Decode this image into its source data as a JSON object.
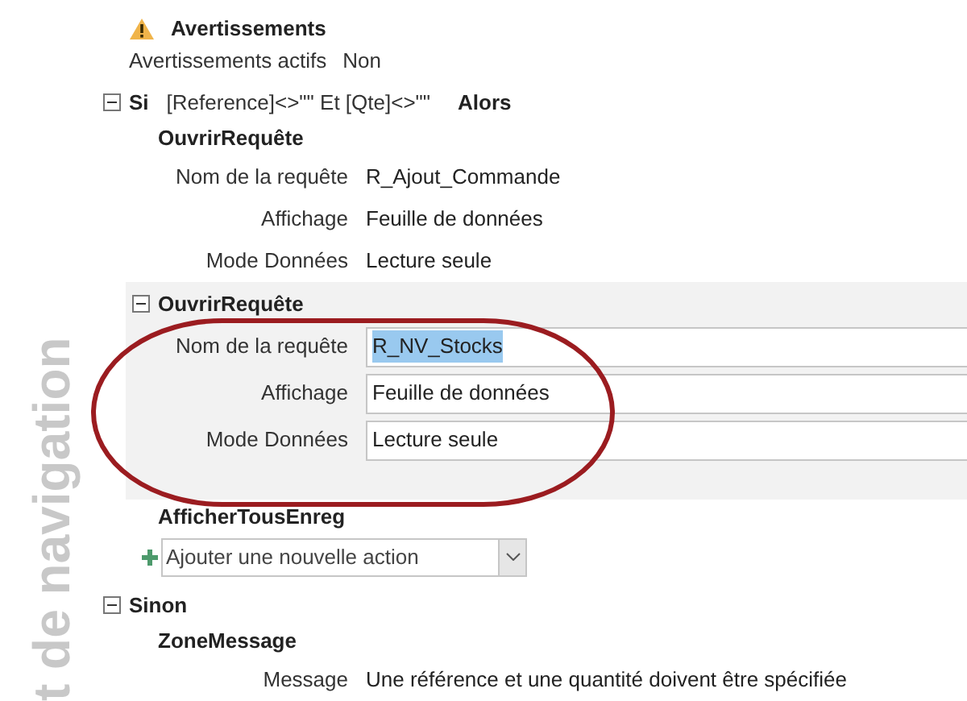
{
  "side_label": "t de navigation",
  "warnings": {
    "title": "Avertissements",
    "label": "Avertissements actifs",
    "value": "Non"
  },
  "if_block": {
    "keyword": "Si",
    "expanded": true,
    "condition": "[Reference]<>\"\" Et [Qte]<>\"\"",
    "then": "Alors",
    "actions": [
      {
        "name": "OuvrirRequête",
        "selected": false,
        "args": [
          {
            "label": "Nom de la requête",
            "value": "R_Ajout_Commande",
            "text_selected": false
          },
          {
            "label": "Affichage",
            "value": "Feuille de données",
            "text_selected": false
          },
          {
            "label": "Mode Données",
            "value": "Lecture seule",
            "text_selected": false
          }
        ]
      },
      {
        "name": "OuvrirRequête",
        "selected": true,
        "args": [
          {
            "label": "Nom de la requête",
            "value": "R_NV_Stocks",
            "text_selected": true
          },
          {
            "label": "Affichage",
            "value": "Feuille de données",
            "text_selected": false
          },
          {
            "label": "Mode Données",
            "value": "Lecture seule",
            "text_selected": false
          }
        ]
      },
      {
        "name": "AfficherTousEnreg",
        "selected": false
      }
    ],
    "add_action": {
      "value": "Ajouter une nouvelle action"
    }
  },
  "else_block": {
    "keyword": "Sinon",
    "expanded": true,
    "actions": [
      {
        "name": "ZoneMessage",
        "selected": false,
        "args": [
          {
            "label": "Message",
            "value": "Une référence et une quantité doivent être spécifiée",
            "text_selected": false
          }
        ]
      }
    ]
  }
}
